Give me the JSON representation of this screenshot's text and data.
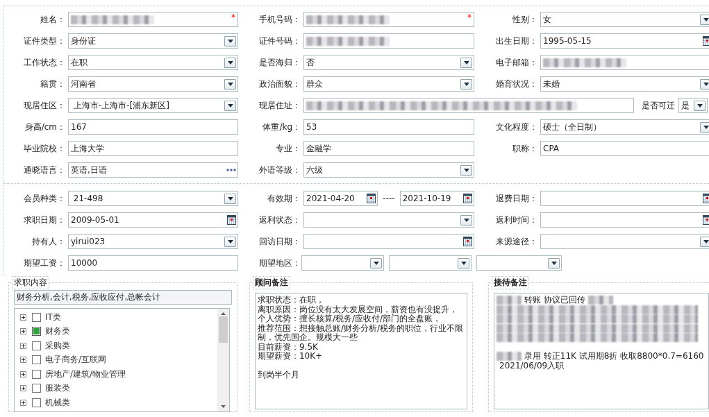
{
  "sections": [
    {
      "rows": [
        [
          {
            "label": "姓名：",
            "kind": "text",
            "redacted": true,
            "required_mark": "*"
          },
          {
            "label": "手机号码：",
            "kind": "text",
            "redacted": true,
            "required_mark": "*"
          },
          {
            "label": "性别：",
            "kind": "select",
            "value": "女"
          }
        ],
        [
          {
            "label": "证件类型：",
            "kind": "select",
            "value": "身份证"
          },
          {
            "label": "证件号码：",
            "kind": "text",
            "redacted": true
          },
          {
            "label": "出生日期：",
            "kind": "date",
            "value": "1995-05-15"
          }
        ],
        [
          {
            "label": "工作状态：",
            "kind": "select",
            "value": "在职"
          },
          {
            "label": "是否海归：",
            "kind": "select",
            "value": "否"
          },
          {
            "label": "电子邮箱：",
            "kind": "text",
            "redacted": true
          }
        ],
        [
          {
            "label": "籍贯：",
            "kind": "select",
            "value": "河南省"
          },
          {
            "label": "政治面貌：",
            "kind": "select",
            "value": "群众"
          },
          {
            "label": "婚育状况：",
            "kind": "select",
            "value": "未婚"
          }
        ],
        [
          {
            "label": "现居住区：",
            "kind": "select",
            "value": " 上海市-上海市-[浦东新区]"
          },
          {
            "label": "现居住址：",
            "kind": "address",
            "redacted": true,
            "transfer": {
              "label": "是否可迁",
              "value": "是"
            }
          }
        ],
        [
          {
            "label": "身高/cm：",
            "kind": "text",
            "value": "167"
          },
          {
            "label": "体重/kg：",
            "kind": "text",
            "value": "53"
          },
          {
            "label": "文化程度：",
            "kind": "select",
            "value": "硕士（全日制）"
          }
        ],
        [
          {
            "label": "毕业院校：",
            "kind": "text",
            "value": "上海大学"
          },
          {
            "label": "专业：",
            "kind": "text",
            "value": "金融学"
          },
          {
            "label": "职称：",
            "kind": "text",
            "value": "CPA"
          }
        ],
        [
          {
            "label": "通晓语言：",
            "kind": "lookup",
            "value": "英语,日语"
          },
          {
            "label": "外语等级：",
            "kind": "select",
            "value": "六级"
          }
        ]
      ]
    },
    {
      "rows": [
        [
          {
            "label": "会员种类：",
            "kind": "select",
            "value": " 21-498"
          },
          {
            "label": "有效期：",
            "kind": "date_range",
            "values": [
              "2021-04-20",
              "2021-10-19"
            ],
            "separator": "----"
          },
          {
            "label": "退费日期：",
            "kind": "date"
          }
        ],
        [
          {
            "label": "求职日期：",
            "kind": "date",
            "value": "2009-05-01"
          },
          {
            "label": "返利状态：",
            "kind": "select"
          },
          {
            "label": "返利时间：",
            "kind": "date"
          }
        ],
        [
          {
            "label": "持有人：",
            "kind": "select",
            "value": "yirui023"
          },
          {
            "label": "回访日期：",
            "kind": "date"
          },
          {
            "label": "来源途径：",
            "kind": "select"
          }
        ],
        [
          {
            "label": "期望工资：",
            "kind": "text",
            "value": "10000"
          },
          {
            "label": "期望地区：",
            "kind": "multi_select",
            "dropdowns": [
              {
                "kind": "select"
              },
              {
                "kind": "select"
              },
              {
                "kind": "select"
              }
            ]
          }
        ]
      ]
    }
  ],
  "job_panel": {
    "legend": "求职内容",
    "summary": "财务分析,会计,税务,应收应付,总帐会计",
    "categories": [
      {
        "label": "IT类",
        "checked": false,
        "expanded": false
      },
      {
        "label": "财务类",
        "checked": true,
        "expanded": false
      },
      {
        "label": "采购类",
        "checked": false,
        "expanded": false
      },
      {
        "label": "电子商务/互联网",
        "checked": false,
        "expanded": false
      },
      {
        "label": "房地产/建筑/物业管理",
        "checked": false,
        "expanded": false
      },
      {
        "label": "服装类",
        "checked": false,
        "expanded": false
      },
      {
        "label": "机械类",
        "checked": false,
        "expanded": false
      }
    ]
  },
  "advisor_panel": {
    "legend": "顾问备注",
    "lines": [
      {
        "text": "求职状态：在职，"
      },
      {
        "text": "离职原因：岗位没有太大发展空间，薪资也有没提升，"
      },
      {
        "text": "个人优势：擅长核算/税务/应收付/部门的全盘账，"
      },
      {
        "text": "推荐范围：想接触总账/财务分析/税务的职位，行业不限制，优先国企。规模大一些"
      },
      {
        "text": "目前薪资：9.5K"
      },
      {
        "text": "期望薪资：10K+"
      },
      {
        "text": "到岗半个月",
        "gap_before": true
      }
    ]
  },
  "reception_panel": {
    "legend": "接待备注",
    "lines": [
      {
        "segments": [
          {
            "kind": "blur"
          },
          {
            "kind": "text",
            "text": "转账 协议已回传"
          },
          {
            "kind": "blur"
          }
        ]
      },
      {
        "segments": [
          {
            "kind": "blur"
          }
        ]
      },
      {
        "segments": [
          {
            "kind": "blur"
          }
        ]
      },
      {
        "segments": [
          {
            "kind": "blur"
          }
        ]
      },
      {
        "segments": [
          {
            "kind": "blur"
          }
        ]
      },
      {
        "gap_before": true,
        "segments": [
          {
            "kind": "blur"
          },
          {
            "kind": "text",
            "text": "录用 转正11K 试用期8折  收取8800*0.7=6160"
          }
        ]
      },
      {
        "segments": [
          {
            "kind": "text",
            "text": "2021/06/09入职"
          }
        ]
      }
    ]
  }
}
